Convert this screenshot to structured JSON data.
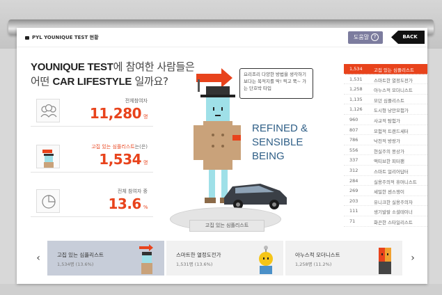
{
  "header": {
    "title": "PYL YOUNIQUE TEST 현황",
    "help_label": "도움말",
    "help_icon": "?",
    "back_label": "BACK"
  },
  "headline": {
    "line1_brand": "YOUNIQUE TEST",
    "line1_rest": "에 참여한 사람들은",
    "line2_pre": "어떤 ",
    "line2_brand": "CAR LIFESTYLE",
    "line2_rest": " 일까요?"
  },
  "stats": [
    {
      "label": "전체참여자",
      "label_highlight": "",
      "label_suffix": "",
      "value": "11,280",
      "unit": "명",
      "icon": "people-group-icon"
    },
    {
      "label": "",
      "label_highlight": "고집 있는 심플리스트",
      "label_suffix": "는(은)",
      "value": "1,534",
      "unit": "명",
      "icon": "mascot-icon"
    },
    {
      "label": "전체 참여자 중",
      "label_highlight": "",
      "label_suffix": "",
      "value": "13.6",
      "unit": "%",
      "icon": "pie-chart-icon"
    }
  ],
  "speech_bubble": "요리조리 다양한 방법을 생각하기 보다는 목적지를 딱! 찍고 쭉~ 가는 단호박 타입",
  "tagline": [
    "REFINED &",
    "SENSIBLE",
    "BEING"
  ],
  "category_label": "고집 있는 심플리스트",
  "ranking": [
    {
      "count": "1,534",
      "name": "고집 있는 심플리스트",
      "active": true
    },
    {
      "count": "1,531",
      "name": "스마트한 열정도전가",
      "active": false
    },
    {
      "count": "1,258",
      "name": "아누스적 모더니스트",
      "active": false
    },
    {
      "count": "1,135",
      "name": "모던 심플리스트",
      "active": false
    },
    {
      "count": "1,126",
      "name": "도시형 낭만모험가",
      "active": false
    },
    {
      "count": "960",
      "name": "사교적 탐험가",
      "active": false
    },
    {
      "count": "807",
      "name": "모험적 트랜드세터",
      "active": false
    },
    {
      "count": "786",
      "name": "낙천적 방랑가",
      "active": false
    },
    {
      "count": "556",
      "name": "현실주의 몽상가",
      "active": false
    },
    {
      "count": "337",
      "name": "액티브한 피터팬",
      "active": false
    },
    {
      "count": "312",
      "name": "스마트 얼리어답터",
      "active": false
    },
    {
      "count": "284",
      "name": "실용주의적 휴머니스트",
      "active": false
    },
    {
      "count": "269",
      "name": "세밀한 센스쟁이",
      "active": false
    },
    {
      "count": "203",
      "name": "유니크한 실용주의자",
      "active": false
    },
    {
      "count": "111",
      "name": "생기발랄 소셜테이너",
      "active": false
    },
    {
      "count": "71",
      "name": "화끈한 스타일리스트",
      "active": false
    }
  ],
  "carousel": {
    "prev_icon": "‹",
    "next_icon": "›",
    "cards": [
      {
        "name": "고집 있는 심플리스트",
        "sub": "1,534명 (13.6%)",
        "active": true
      },
      {
        "name": "스마트한 열정도전가",
        "sub": "1,531명 (13.6%)",
        "active": false
      },
      {
        "name": "아누스적 모더니스트",
        "sub": "1,258명 (11.2%)",
        "active": false
      }
    ]
  },
  "colors": {
    "accent": "#e8431c",
    "tagline": "#2f5f87",
    "help": "#7c7c9e"
  }
}
